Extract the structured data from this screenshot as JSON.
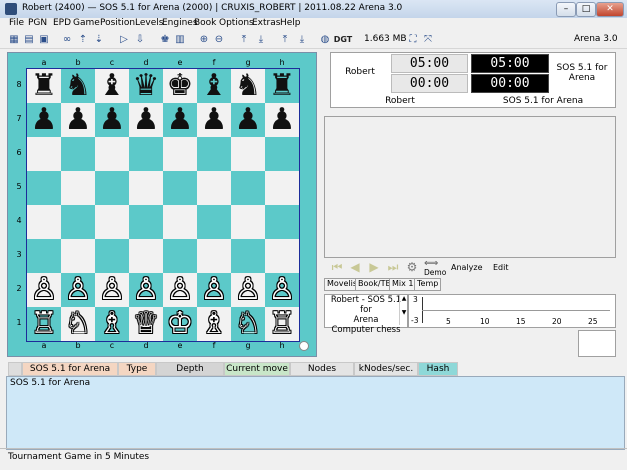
{
  "window": {
    "title": "Robert (2400)  — SOS 5.1 for Arena (2000)  |  CRUXIS_ROBERT  |  2011.08.22  Arena 3.0",
    "buttons": {
      "minimize": "–",
      "maximize": "□",
      "close": "✕"
    }
  },
  "menu": [
    "File",
    "PGN",
    "EPD",
    "Game",
    "Position",
    "Levels",
    "Engines",
    "Book",
    "Options",
    "Extras",
    "Help"
  ],
  "toolbar": {
    "memory": "1.663 MB",
    "version": "Arena 3.0",
    "icons": [
      "flip-board-icon",
      "open-icon",
      "save-icon",
      "infinite-icon",
      "lev-up-icon",
      "lev-down-icon",
      "play-icon",
      "hint-icon",
      "board-setup-icon",
      "clock-icon",
      "zoom-in-icon",
      "zoom-out-icon",
      "pgn-in-icon",
      "pgn-out-icon",
      "epd-in-icon",
      "epd-out-icon",
      "globe-icon",
      "dgt-icon",
      "fullscreen-icon",
      "resize-icon"
    ]
  },
  "board": {
    "files": [
      "a",
      "b",
      "c",
      "d",
      "e",
      "f",
      "g",
      "h"
    ],
    "ranks": [
      "8",
      "7",
      "6",
      "5",
      "4",
      "3",
      "2",
      "1"
    ],
    "rows": [
      [
        "♜",
        "♞",
        "♝",
        "♛",
        "♚",
        "♝",
        "♞",
        "♜"
      ],
      [
        "♟",
        "♟",
        "♟",
        "♟",
        "♟",
        "♟",
        "♟",
        "♟"
      ],
      [
        "",
        "",
        "",
        "",
        "",
        "",
        "",
        ""
      ],
      [
        "",
        "",
        "",
        "",
        "",
        "",
        "",
        ""
      ],
      [
        "",
        "",
        "",
        "",
        "",
        "",
        "",
        ""
      ],
      [
        "",
        "",
        "",
        "",
        "",
        "",
        "",
        ""
      ],
      [
        "♙",
        "♙",
        "♙",
        "♙",
        "♙",
        "♙",
        "♙",
        "♙"
      ],
      [
        "♖",
        "♘",
        "♗",
        "♕",
        "♔",
        "♗",
        "♘",
        "♖"
      ]
    ],
    "colors": {
      "light": "#f2f2f2",
      "dark": "#5cc9c9",
      "frame": "#5cc9c9"
    }
  },
  "clock": {
    "white_player": "Robert",
    "black_player": "SOS 5.1 for Arena",
    "white_time": "05:00",
    "white_extra": "00:00",
    "black_time": "05:00",
    "black_extra": "00:00",
    "white_name_bottom": "Robert",
    "black_name_bottom": "SOS 5.1 for Arena"
  },
  "navigation": {
    "demo_label": "Demo",
    "analyze_label": "Analyze",
    "edit_label": "Edit"
  },
  "tabs": [
    "Movelist",
    "Book/TB",
    "Mix 1",
    "Temp"
  ],
  "engine_panel": {
    "line1": "Robert - SOS 5.1 for",
    "line2": "Arena",
    "line3": "Computer chess"
  },
  "graph": {
    "y_top": "3",
    "y_bottom": "-3",
    "x_ticks": [
      "5",
      "10",
      "15",
      "20",
      "25"
    ]
  },
  "infobar": {
    "engine": "SOS 5.1 for Arena",
    "type": "Type",
    "depth": "Depth",
    "current_move": "Current move",
    "nodes": "Nodes",
    "knodes": "kNodes/sec.",
    "hash": "Hash"
  },
  "output": {
    "text": "SOS 5.1 for Arena"
  },
  "status": {
    "text": "Tournament Game in 5 Minutes"
  }
}
